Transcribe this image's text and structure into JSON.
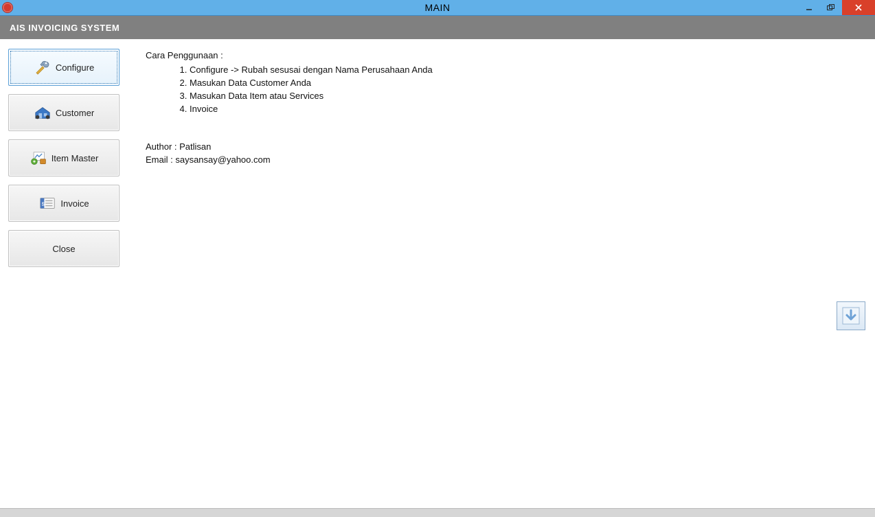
{
  "window": {
    "title": "MAIN"
  },
  "subheader": {
    "title": "AIS INVOICING SYSTEM"
  },
  "sidebar": {
    "items": [
      {
        "label": "Configure",
        "icon": "tools-icon",
        "selected": true
      },
      {
        "label": "Customer",
        "icon": "customer-icon",
        "selected": false
      },
      {
        "label": "Item Master",
        "icon": "item-master-icon",
        "selected": false
      },
      {
        "label": "Invoice",
        "icon": "invoice-icon",
        "selected": false
      },
      {
        "label": "Close",
        "icon": "",
        "selected": false
      }
    ]
  },
  "content": {
    "heading": "Cara Penggunaan :",
    "steps": [
      "Configure -> Rubah sesusai dengan Nama Perusahaan Anda",
      "Masukan Data Customer Anda",
      "Masukan Data Item atau Services",
      "Invoice"
    ],
    "author_line": "Author : Patlisan",
    "email_line": "Email : saysansay@yahoo.com"
  }
}
